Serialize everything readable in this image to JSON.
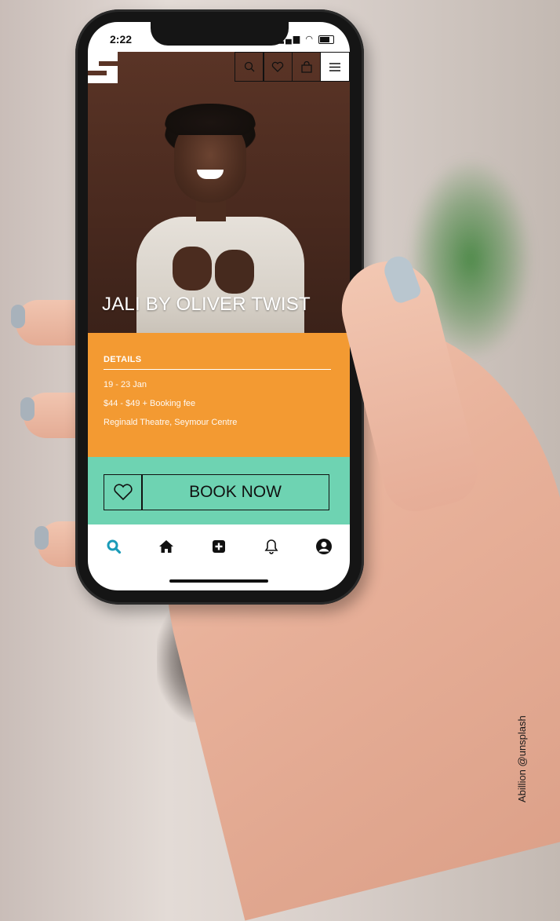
{
  "status_bar": {
    "time": "2:22"
  },
  "header": {
    "icons": [
      "search-icon",
      "heart-icon",
      "bag-icon",
      "menu-icon"
    ]
  },
  "hero": {
    "title": "JALI BY OLIVER TWIST"
  },
  "details": {
    "heading": "DETAILS",
    "date": "19 - 23 Jan",
    "price": "$44 - $49 + Booking fee",
    "venue": "Reginald Theatre, Seymour Centre"
  },
  "actions": {
    "book_label": "BOOK NOW"
  },
  "tabbar": {
    "items": [
      "search-icon",
      "home-icon",
      "add-icon",
      "bell-icon",
      "profile-icon"
    ]
  },
  "photo_credit": "Abillion @unsplash",
  "colors": {
    "details_bg": "#f39a32",
    "book_bg": "#6ed3b2",
    "active_tab": "#1a9bb8",
    "hero_bg": "#4a2a1f"
  }
}
